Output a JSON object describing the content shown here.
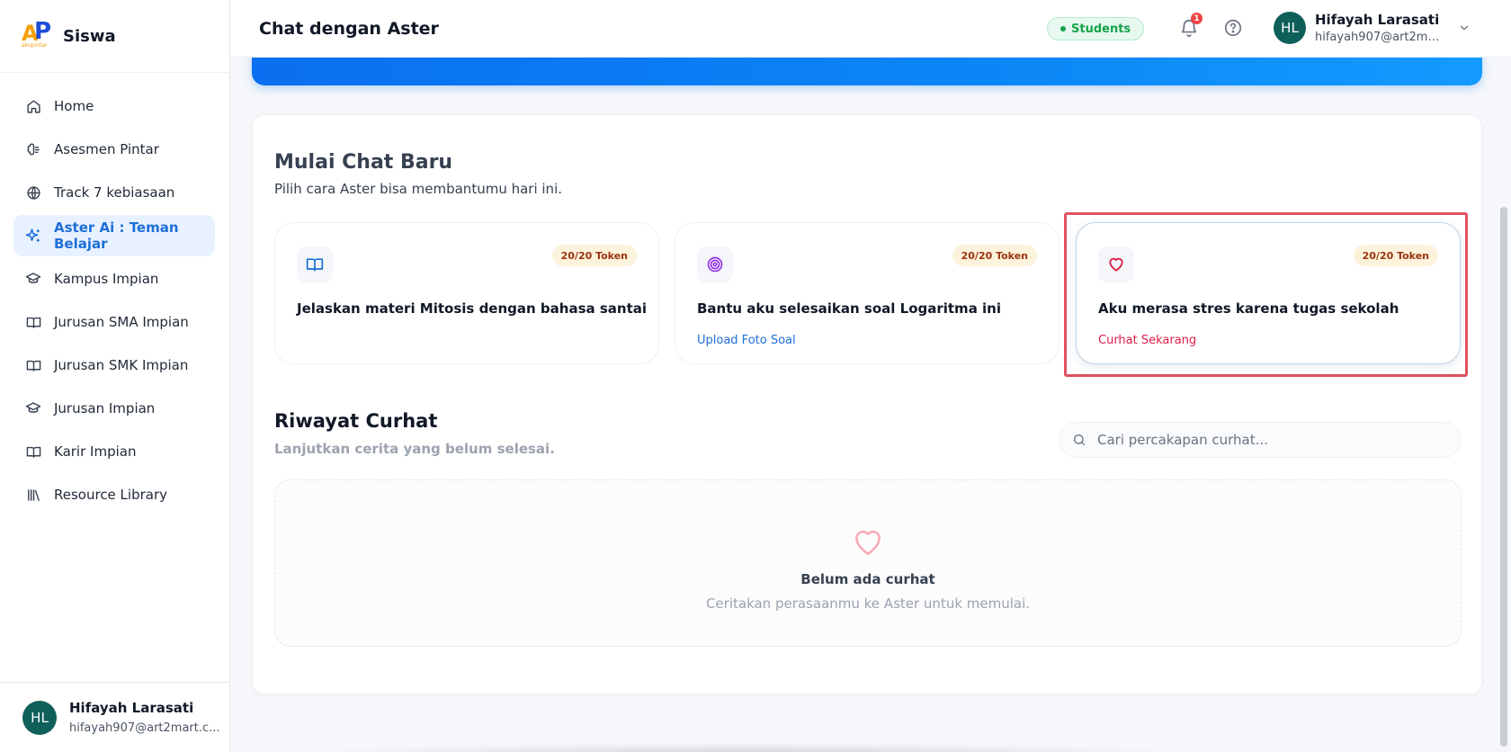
{
  "app": {
    "brand_name": "Siswa",
    "logo_sub": "akupintar"
  },
  "sidebar": {
    "items": [
      {
        "label": "Home",
        "icon": "home-icon"
      },
      {
        "label": "Asesmen Pintar",
        "icon": "brain-icon"
      },
      {
        "label": "Track 7 kebiasaan",
        "icon": "globe-icon"
      },
      {
        "label": "Aster Ai : Teman Belajar",
        "icon": "sparkles-icon",
        "active": true
      },
      {
        "label": "Kampus Impian",
        "icon": "graduation-cap-icon"
      },
      {
        "label": "Jurusan SMA Impian",
        "icon": "book-icon"
      },
      {
        "label": "Jurusan SMK Impian",
        "icon": "book-icon"
      },
      {
        "label": "Jurusan Impian",
        "icon": "graduation-cap-icon"
      },
      {
        "label": "Karir Impian",
        "icon": "book-icon"
      },
      {
        "label": "Resource Library",
        "icon": "library-icon"
      }
    ],
    "user": {
      "initials": "HL",
      "name": "Hifayah Larasati",
      "email": "hifayah907@art2mart.c..."
    }
  },
  "header": {
    "title": "Chat dengan Aster",
    "role_badge": "Students",
    "notification_count": "1",
    "user": {
      "initials": "HL",
      "name": "Hifayah Larasati",
      "email": "hifayah907@art2mar..."
    }
  },
  "new_chat": {
    "title": "Mulai Chat Baru",
    "subtitle": "Pilih cara Aster bisa membantumu hari ini.",
    "cards": [
      {
        "icon": "book-open-icon",
        "token": "20/20 Token",
        "title": "Jelaskan materi Mitosis dengan bahasa santai",
        "link": ""
      },
      {
        "icon": "target-icon",
        "token": "20/20 Token",
        "title": "Bantu aku selesaikan soal Logaritma ini",
        "link": "Upload Foto Soal"
      },
      {
        "icon": "heart-icon",
        "token": "20/20 Token",
        "title": "Aku merasa stres karena tugas sekolah",
        "link": "Curhat Sekarang"
      }
    ]
  },
  "history": {
    "title": "Riwayat Curhat",
    "subtitle": "Lanjutkan cerita yang belum selesai.",
    "search_placeholder": "Cari percakapan curhat...",
    "search_value": "",
    "empty_title": "Belum ada curhat",
    "empty_subtitle": "Ceritakan perasaanmu ke Aster untuk memulai."
  },
  "colors": {
    "accent": "#1d6fd8",
    "banner": "#0a6ff0",
    "success": "#16a34a",
    "danger": "#e11d48",
    "highlight_frame": "#e05260"
  }
}
